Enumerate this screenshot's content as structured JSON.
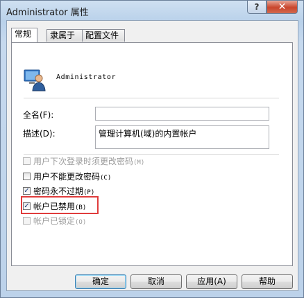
{
  "window": {
    "title": "Administrator 属性",
    "help_glyph": "?",
    "close_glyph": "✕"
  },
  "tabs": [
    {
      "label": "常规",
      "active": true
    },
    {
      "label": "隶属于",
      "active": false
    },
    {
      "label": "配置文件",
      "active": false
    }
  ],
  "general": {
    "username": "Administrator",
    "fullname_label": "全名(F):",
    "fullname_value": "",
    "description_label": "描述(D):",
    "description_value": "管理计算机(域)的内置帐户"
  },
  "options": [
    {
      "label": "用户下次登录时须更改密码",
      "shortcut": "(M)",
      "checked": false,
      "enabled": false
    },
    {
      "label": "用户不能更改密码",
      "shortcut": "(C)",
      "checked": false,
      "enabled": true
    },
    {
      "label": "密码永不过期",
      "shortcut": "(P)",
      "checked": true,
      "enabled": true
    },
    {
      "label": "帐户已禁用",
      "shortcut": "(B)",
      "checked": true,
      "enabled": true,
      "highlighted": true
    },
    {
      "label": "帐户已锁定",
      "shortcut": "(O)",
      "checked": false,
      "enabled": false
    }
  ],
  "buttons": {
    "ok": "确定",
    "cancel": "取消",
    "apply": "应用(A)",
    "help": "帮助"
  },
  "colors": {
    "highlight_border": "#e03c3c",
    "title_bar": "#b9d1ea",
    "close_button": "#c9452c"
  }
}
